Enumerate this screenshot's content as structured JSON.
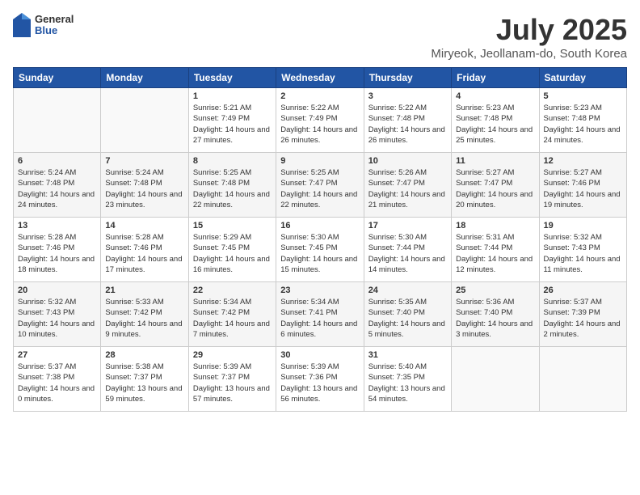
{
  "header": {
    "logo": {
      "general": "General",
      "blue": "Blue"
    },
    "title": "July 2025",
    "location": "Miryeok, Jeollanam-do, South Korea"
  },
  "weekdays": [
    "Sunday",
    "Monday",
    "Tuesday",
    "Wednesday",
    "Thursday",
    "Friday",
    "Saturday"
  ],
  "weeks": [
    [
      {
        "day": "",
        "info": ""
      },
      {
        "day": "",
        "info": ""
      },
      {
        "day": "1",
        "info": "Sunrise: 5:21 AM\nSunset: 7:49 PM\nDaylight: 14 hours and 27 minutes."
      },
      {
        "day": "2",
        "info": "Sunrise: 5:22 AM\nSunset: 7:49 PM\nDaylight: 14 hours and 26 minutes."
      },
      {
        "day": "3",
        "info": "Sunrise: 5:22 AM\nSunset: 7:48 PM\nDaylight: 14 hours and 26 minutes."
      },
      {
        "day": "4",
        "info": "Sunrise: 5:23 AM\nSunset: 7:48 PM\nDaylight: 14 hours and 25 minutes."
      },
      {
        "day": "5",
        "info": "Sunrise: 5:23 AM\nSunset: 7:48 PM\nDaylight: 14 hours and 24 minutes."
      }
    ],
    [
      {
        "day": "6",
        "info": "Sunrise: 5:24 AM\nSunset: 7:48 PM\nDaylight: 14 hours and 24 minutes."
      },
      {
        "day": "7",
        "info": "Sunrise: 5:24 AM\nSunset: 7:48 PM\nDaylight: 14 hours and 23 minutes."
      },
      {
        "day": "8",
        "info": "Sunrise: 5:25 AM\nSunset: 7:48 PM\nDaylight: 14 hours and 22 minutes."
      },
      {
        "day": "9",
        "info": "Sunrise: 5:25 AM\nSunset: 7:47 PM\nDaylight: 14 hours and 22 minutes."
      },
      {
        "day": "10",
        "info": "Sunrise: 5:26 AM\nSunset: 7:47 PM\nDaylight: 14 hours and 21 minutes."
      },
      {
        "day": "11",
        "info": "Sunrise: 5:27 AM\nSunset: 7:47 PM\nDaylight: 14 hours and 20 minutes."
      },
      {
        "day": "12",
        "info": "Sunrise: 5:27 AM\nSunset: 7:46 PM\nDaylight: 14 hours and 19 minutes."
      }
    ],
    [
      {
        "day": "13",
        "info": "Sunrise: 5:28 AM\nSunset: 7:46 PM\nDaylight: 14 hours and 18 minutes."
      },
      {
        "day": "14",
        "info": "Sunrise: 5:28 AM\nSunset: 7:46 PM\nDaylight: 14 hours and 17 minutes."
      },
      {
        "day": "15",
        "info": "Sunrise: 5:29 AM\nSunset: 7:45 PM\nDaylight: 14 hours and 16 minutes."
      },
      {
        "day": "16",
        "info": "Sunrise: 5:30 AM\nSunset: 7:45 PM\nDaylight: 14 hours and 15 minutes."
      },
      {
        "day": "17",
        "info": "Sunrise: 5:30 AM\nSunset: 7:44 PM\nDaylight: 14 hours and 14 minutes."
      },
      {
        "day": "18",
        "info": "Sunrise: 5:31 AM\nSunset: 7:44 PM\nDaylight: 14 hours and 12 minutes."
      },
      {
        "day": "19",
        "info": "Sunrise: 5:32 AM\nSunset: 7:43 PM\nDaylight: 14 hours and 11 minutes."
      }
    ],
    [
      {
        "day": "20",
        "info": "Sunrise: 5:32 AM\nSunset: 7:43 PM\nDaylight: 14 hours and 10 minutes."
      },
      {
        "day": "21",
        "info": "Sunrise: 5:33 AM\nSunset: 7:42 PM\nDaylight: 14 hours and 9 minutes."
      },
      {
        "day": "22",
        "info": "Sunrise: 5:34 AM\nSunset: 7:42 PM\nDaylight: 14 hours and 7 minutes."
      },
      {
        "day": "23",
        "info": "Sunrise: 5:34 AM\nSunset: 7:41 PM\nDaylight: 14 hours and 6 minutes."
      },
      {
        "day": "24",
        "info": "Sunrise: 5:35 AM\nSunset: 7:40 PM\nDaylight: 14 hours and 5 minutes."
      },
      {
        "day": "25",
        "info": "Sunrise: 5:36 AM\nSunset: 7:40 PM\nDaylight: 14 hours and 3 minutes."
      },
      {
        "day": "26",
        "info": "Sunrise: 5:37 AM\nSunset: 7:39 PM\nDaylight: 14 hours and 2 minutes."
      }
    ],
    [
      {
        "day": "27",
        "info": "Sunrise: 5:37 AM\nSunset: 7:38 PM\nDaylight: 14 hours and 0 minutes."
      },
      {
        "day": "28",
        "info": "Sunrise: 5:38 AM\nSunset: 7:37 PM\nDaylight: 13 hours and 59 minutes."
      },
      {
        "day": "29",
        "info": "Sunrise: 5:39 AM\nSunset: 7:37 PM\nDaylight: 13 hours and 57 minutes."
      },
      {
        "day": "30",
        "info": "Sunrise: 5:39 AM\nSunset: 7:36 PM\nDaylight: 13 hours and 56 minutes."
      },
      {
        "day": "31",
        "info": "Sunrise: 5:40 AM\nSunset: 7:35 PM\nDaylight: 13 hours and 54 minutes."
      },
      {
        "day": "",
        "info": ""
      },
      {
        "day": "",
        "info": ""
      }
    ]
  ]
}
